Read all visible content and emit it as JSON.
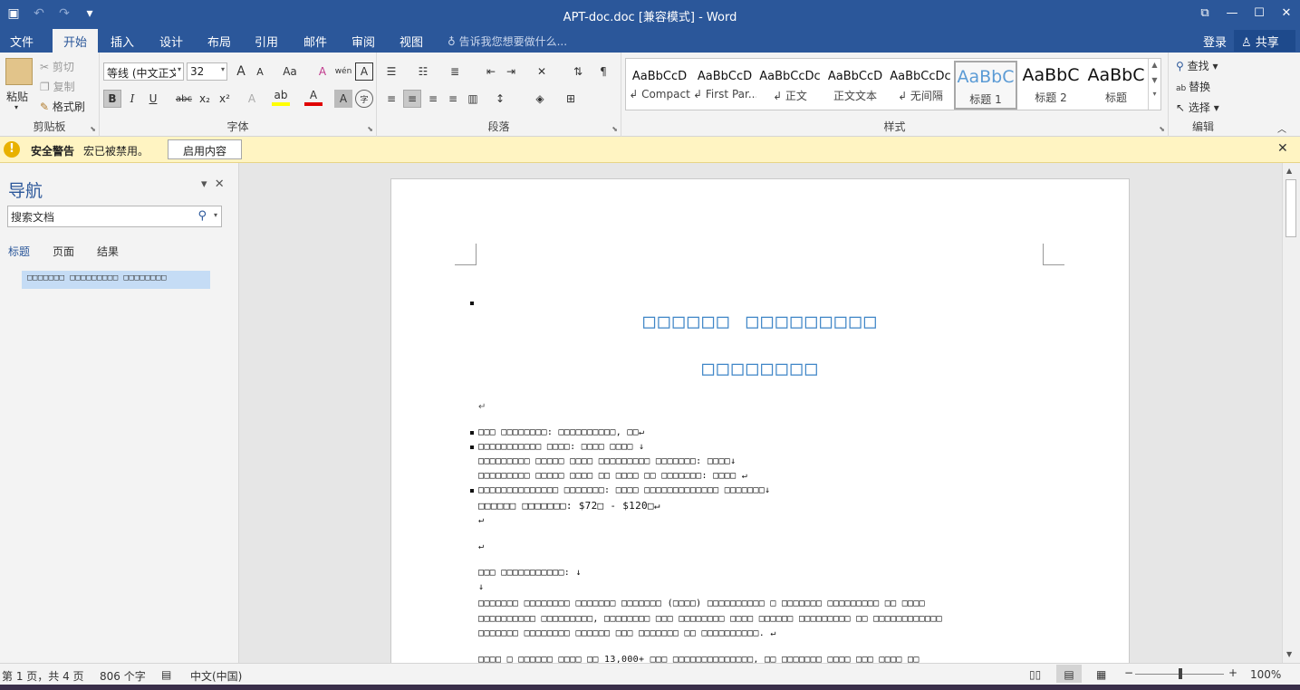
{
  "window": {
    "title": "APT-doc.doc [兼容模式] - Word",
    "save_icon": "💾",
    "undo_icon": "↶",
    "redo_icon": "↷",
    "qat_more_icon": "▾",
    "restore_ribbon_icon": "⧉",
    "minimize_icon": "—",
    "maximize_icon": "☐",
    "close_icon": "✕"
  },
  "tabs": [
    "文件",
    "开始",
    "插入",
    "设计",
    "布局",
    "引用",
    "邮件",
    "审阅",
    "视图"
  ],
  "tell_me": "告诉我您想要做什么...",
  "login": "登录",
  "share": "共享",
  "ribbon": {
    "clipboard": {
      "label": "剪贴板",
      "paste": "粘贴",
      "cut": "剪切",
      "copy": "复制",
      "format_painter": "格式刷"
    },
    "font": {
      "label": "字体",
      "font_name": "等线 (中文正文)",
      "font_size": "32",
      "grow": "A",
      "shrink": "A",
      "change_case": "Aa",
      "clear": "A",
      "phonetic": "wén",
      "border_char": "A",
      "bold": "B",
      "italic": "I",
      "underline": "U",
      "strike": "abc",
      "subscript": "x₂",
      "superscript": "x²",
      "text_effect": "A",
      "highlight": "ab",
      "font_color": "A",
      "shading": "A",
      "enclose": "字",
      "highlight_color": "#ffff00",
      "font_color_value": "#e00000"
    },
    "paragraph": {
      "label": "段落"
    },
    "styles": {
      "label": "样式",
      "items": [
        {
          "sample": "AaBbCcD",
          "name": "↲ Compact"
        },
        {
          "sample": "AaBbCcD",
          "name": "↲ First Par..."
        },
        {
          "sample": "AaBbCcDc",
          "name": "↲ 正文"
        },
        {
          "sample": "AaBbCcD",
          "name": "正文文本"
        },
        {
          "sample": "AaBbCcDc",
          "name": "↲ 无间隔"
        },
        {
          "sample": "AaBbC",
          "name": "标题 1"
        },
        {
          "sample": "AaBbC",
          "name": "标题 2"
        },
        {
          "sample": "AaBbC",
          "name": "标题"
        }
      ]
    },
    "editing": {
      "label": "编辑",
      "find": "查找",
      "replace": "替换",
      "select": "选择"
    }
  },
  "security": {
    "title": "安全警告",
    "message": "宏已被禁用。",
    "enable": "启用内容",
    "warn_glyph": "!",
    "close": "✕"
  },
  "nav": {
    "title": "导航",
    "search_placeholder": "搜索文档",
    "tabs": [
      "标题",
      "页面",
      "结果"
    ],
    "heading": "□□□□□□□ □□□□□□□□□ □□□□□□□□"
  },
  "document": {
    "title_line1": "□□□□□□ □□□□□□□□□",
    "title_line2": "□□□□□□□□",
    "pilcrow": "↵",
    "lines": [
      "□□□ □□□□□□□□: □□□□□□□□□□, □□↵",
      "□□□□□□□□□□□ □□□□: □□□□ □□□□ ↓",
      "□□□□□□□□□ □□□□□ □□□□ □□□□□□□□□ □□□□□□□: □□□□↓",
      "□□□□□□□□□ □□□□□ □□□□ □□ □□□□ □□ □□□□□□□: □□□□ ↵",
      "□□□□□□□□□□□□□□ □□□□□□□: □□□□ □□□□□□□□□□□□□ □□□□□□□↓",
      "□□□□□□ □□□□□□□: $72□ - $120□↵",
      "↵",
      "↵",
      "□□□ □□□□□□□□□□□: ↓",
      "↓",
      "□□□□□□□ □□□□□□□□ □□□□□□□ □□□□□□□ (□□□□) □□□□□□□□□□ □ □□□□□□□ □□□□□□□□□ □□ □□□□",
      "□□□□□□□□□□ □□□□□□□□□, □□□□□□□□ □□□ □□□□□□□□ □□□□ □□□□□□ □□□□□□□□□ □□ □□□□□□□□□□□□",
      "□□□□□□□ □□□□□□□□ □□□□□□ □□□ □□□□□□□ □□ □□□□□□□□□□. ↵",
      "□□□□ □ □□□□□□ □□□□ □□ 13,000+ □□□ □□□□□□□□□□□□□□, □□ □□□□□□□ □□□□ □□□ □□□□ □□"
    ]
  },
  "status": {
    "page": "第 1 页，共 4 页",
    "words": "806 个字",
    "language": "中文(中国)",
    "zoom_minus": "−",
    "zoom_plus": "+",
    "zoom": "100%"
  }
}
